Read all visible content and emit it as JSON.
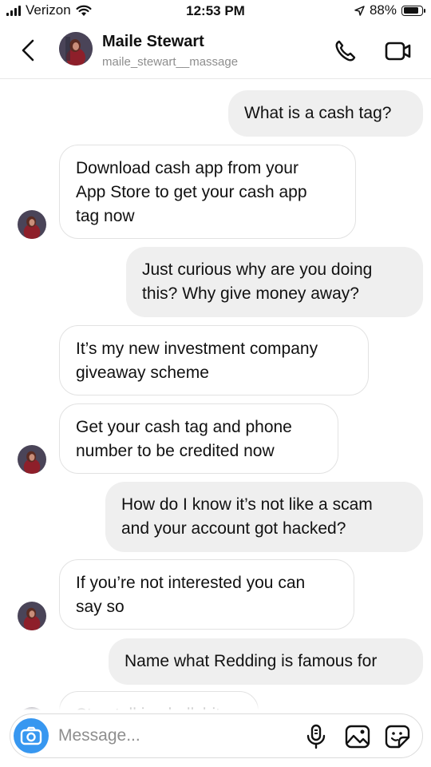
{
  "status_bar": {
    "carrier": "Verizon",
    "time": "12:53 PM",
    "battery_text": "88%",
    "battery_level": 0.88
  },
  "header": {
    "name": "Maile Stewart",
    "username": "maile_stewart__massage"
  },
  "messages": [
    {
      "side": "out",
      "text": "What is a cash tag?"
    },
    {
      "side": "in",
      "text": "Download cash app from your\nApp Store to get your cash app\ntag now",
      "avatar": true
    },
    {
      "side": "out",
      "text": "Just curious why are you doing\nthis? Why give money away?"
    },
    {
      "side": "in",
      "text": "It’s my new investment company\ngiveaway scheme",
      "avatar": false
    },
    {
      "side": "in",
      "text": "Get your cash tag and phone\nnumber to be credited now",
      "avatar": true
    },
    {
      "side": "out",
      "text": "How do I know it’s not like a scam\nand your account got hacked?"
    },
    {
      "side": "in",
      "text": "If you’re not interested you can\nsay so",
      "avatar": true
    },
    {
      "side": "out",
      "text": "Name what Redding is famous for"
    },
    {
      "side": "in",
      "text": "Stop talking bullshit",
      "avatar": true
    }
  ],
  "composer": {
    "placeholder": "Message..."
  },
  "colors": {
    "accent": "#3797f0",
    "outgoing_bubble": "#efefef",
    "incoming_border": "#e2e2e2",
    "secondary_text": "#8e8e8e"
  },
  "icons": {
    "back": "chevron-left-icon",
    "call": "phone-icon",
    "video": "video-camera-icon",
    "camera": "camera-icon",
    "mic": "microphone-icon",
    "gallery": "image-icon",
    "sticker": "sticker-icon"
  }
}
